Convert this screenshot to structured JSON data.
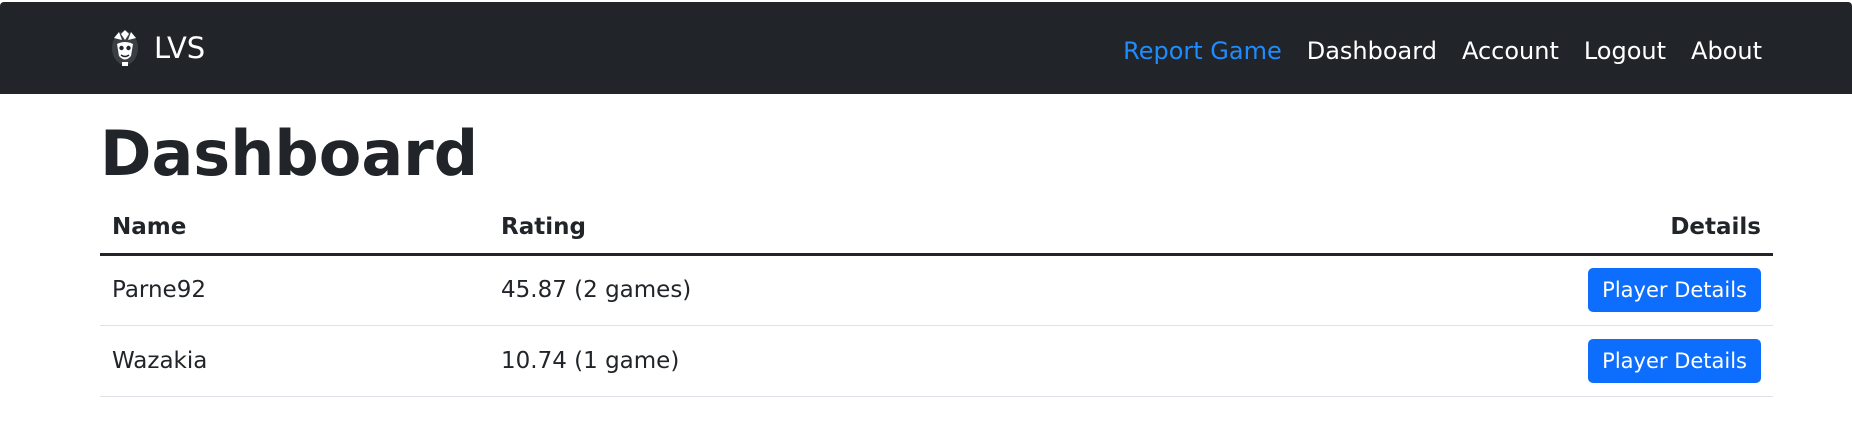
{
  "navbar": {
    "brand_name": "LVS",
    "brand_icon": "jester-mask-logo",
    "links": [
      {
        "label": "Report Game",
        "active": true
      },
      {
        "label": "Dashboard",
        "active": false
      },
      {
        "label": "Account",
        "active": false
      },
      {
        "label": "Logout",
        "active": false
      },
      {
        "label": "About",
        "active": false
      }
    ]
  },
  "page": {
    "title": "Dashboard"
  },
  "table": {
    "headers": {
      "name": "Name",
      "rating": "Rating",
      "details": "Details"
    },
    "rows": [
      {
        "name": "Parne92",
        "rating": "45.87 (2 games)",
        "details_label": "Player Details"
      },
      {
        "name": "Wazakia",
        "rating": "10.74 (1 game)",
        "details_label": "Player Details"
      }
    ]
  },
  "colors": {
    "navbar_bg": "#212529",
    "active_link": "#1e8cff",
    "button_primary": "#0d6efd"
  }
}
